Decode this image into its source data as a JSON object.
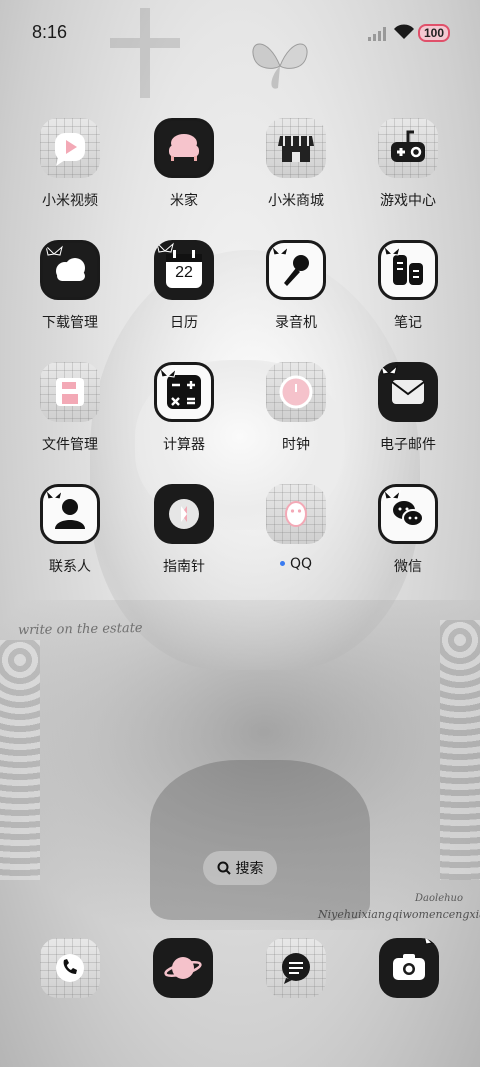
{
  "status_bar": {
    "time": "8:16",
    "battery_level": "100"
  },
  "apps": [
    {
      "label": "小米视频",
      "icon": "video-play-icon"
    },
    {
      "label": "米家",
      "icon": "sofa-icon"
    },
    {
      "label": "小米商城",
      "icon": "store-icon"
    },
    {
      "label": "游戏中心",
      "icon": "gamepad-icon"
    },
    {
      "label": "下载管理",
      "icon": "cloud-download-icon"
    },
    {
      "label": "日历",
      "icon": "calendar-icon",
      "date": "22"
    },
    {
      "label": "录音机",
      "icon": "microphone-icon"
    },
    {
      "label": "笔记",
      "icon": "notes-icon"
    },
    {
      "label": "文件管理",
      "icon": "folder-icon"
    },
    {
      "label": "计算器",
      "icon": "calculator-icon"
    },
    {
      "label": "时钟",
      "icon": "clock-icon"
    },
    {
      "label": "电子邮件",
      "icon": "mail-icon"
    },
    {
      "label": "联系人",
      "icon": "contact-person-icon"
    },
    {
      "label": "指南针",
      "icon": "compass-icon"
    },
    {
      "label": "QQ",
      "icon": "qq-penguin-icon"
    },
    {
      "label": "微信",
      "icon": "wechat-icon"
    }
  ],
  "search": {
    "label": "搜索"
  },
  "dock": [
    {
      "icon": "phone-icon"
    },
    {
      "icon": "planet-browser-icon"
    },
    {
      "icon": "message-bubble-icon"
    },
    {
      "icon": "camera-icon"
    }
  ],
  "wallpaper": {
    "text_top": "write on the estate",
    "text_bottom_1": "Niyehuixiangqiwomencengxiang",
    "text_bottom_2": "Daolehuo"
  },
  "colors": {
    "accent_pink": "#f3c8d1",
    "battery_border": "#e0506a",
    "notification_dot": "#3a7bf0"
  }
}
